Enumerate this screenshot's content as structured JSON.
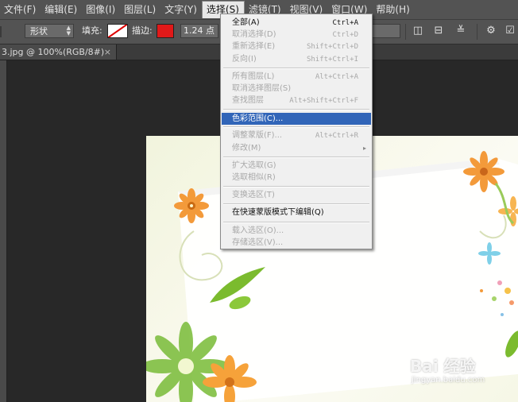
{
  "menubar": {
    "items": [
      {
        "label": "文件(F)"
      },
      {
        "label": "编辑(E)"
      },
      {
        "label": "图像(I)"
      },
      {
        "label": "图层(L)"
      },
      {
        "label": "文字(Y)"
      },
      {
        "label": "选择(S)",
        "active": true
      },
      {
        "label": "滤镜(T)"
      },
      {
        "label": "视图(V)"
      },
      {
        "label": "窗口(W)"
      },
      {
        "label": "帮助(H)"
      }
    ]
  },
  "options_bar": {
    "mode_select": "形状",
    "fill_label": "填充:",
    "stroke_label": "描边:",
    "stroke_width": "1.24 点",
    "stroke_color": "#e11919",
    "fill": "none"
  },
  "document_tab": {
    "title": "3.jpg @ 100%(RGB/8#)",
    "close_glyph": "×"
  },
  "select_menu": {
    "groups": [
      [
        {
          "label": "全部(A)",
          "shortcut": "Ctrl+A",
          "enabled": true
        },
        {
          "label": "取消选择(D)",
          "shortcut": "Ctrl+D",
          "enabled": false
        },
        {
          "label": "重新选择(E)",
          "shortcut": "Shift+Ctrl+D",
          "enabled": false
        },
        {
          "label": "反向(I)",
          "shortcut": "Shift+Ctrl+I",
          "enabled": false
        }
      ],
      [
        {
          "label": "所有图层(L)",
          "shortcut": "Alt+Ctrl+A",
          "enabled": false
        },
        {
          "label": "取消选择图层(S)",
          "shortcut": "",
          "enabled": false
        },
        {
          "label": "查找图层",
          "shortcut": "Alt+Shift+Ctrl+F",
          "enabled": false
        }
      ],
      [
        {
          "label": "色彩范围(C)...",
          "shortcut": "",
          "enabled": true,
          "highlighted": true
        }
      ],
      [
        {
          "label": "调整蒙版(F)...",
          "shortcut": "Alt+Ctrl+R",
          "enabled": false
        },
        {
          "label": "修改(M)",
          "shortcut": "",
          "enabled": false,
          "submenu": true
        }
      ],
      [
        {
          "label": "扩大选取(G)",
          "shortcut": "",
          "enabled": false
        },
        {
          "label": "选取相似(R)",
          "shortcut": "",
          "enabled": false
        }
      ],
      [
        {
          "label": "变换选区(T)",
          "shortcut": "",
          "enabled": false
        }
      ],
      [
        {
          "label": "在快速蒙版模式下编辑(Q)",
          "shortcut": "",
          "enabled": true
        }
      ],
      [
        {
          "label": "载入选区(O)...",
          "shortcut": "",
          "enabled": false
        },
        {
          "label": "存储选区(V)...",
          "shortcut": "",
          "enabled": false
        }
      ]
    ]
  },
  "watermark": {
    "logo": "Bai 经验",
    "url": "jingyan.baidu.com"
  },
  "colors": {
    "menubar_bg": "#535353",
    "workspace_bg": "#282828",
    "highlight": "#3165b8"
  }
}
